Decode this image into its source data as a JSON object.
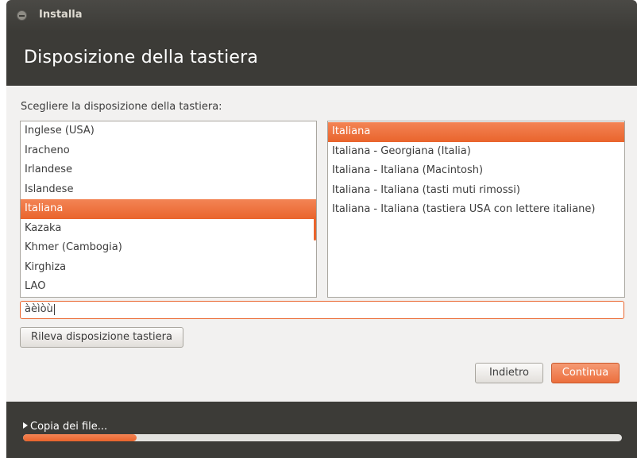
{
  "window": {
    "title": "Installa"
  },
  "header": {
    "title": "Disposizione della tastiera"
  },
  "main": {
    "prompt": "Scegliere la disposizione della tastiera:",
    "layouts": [
      {
        "label": "Inglese (USA)",
        "selected": false
      },
      {
        "label": "Iracheno",
        "selected": false
      },
      {
        "label": "Irlandese",
        "selected": false
      },
      {
        "label": "Islandese",
        "selected": false
      },
      {
        "label": "Italiana",
        "selected": true
      },
      {
        "label": "Kazaka",
        "selected": false
      },
      {
        "label": "Khmer (Cambogia)",
        "selected": false
      },
      {
        "label": "Kirghiza",
        "selected": false
      },
      {
        "label": "LAO",
        "selected": false
      }
    ],
    "variants": [
      {
        "label": "Italiana",
        "selected": true
      },
      {
        "label": "Italiana - Georgiana (Italia)",
        "selected": false
      },
      {
        "label": "Italiana - Italiana (Macintosh)",
        "selected": false
      },
      {
        "label": "Italiana - Italiana (tasti muti rimossi)",
        "selected": false
      },
      {
        "label": "Italiana - Italiana (tastiera USA con lettere italiane)",
        "selected": false
      }
    ],
    "test_input_value": "àèìòù",
    "detect_button": "Rileva disposizione tastiera"
  },
  "buttons": {
    "back": "Indietro",
    "continue": "Continua"
  },
  "footer": {
    "status": "Copia dei file...",
    "progress": 0.19
  },
  "colors": {
    "accent": "#e9642c",
    "header_bg": "#3c3b37",
    "content_bg": "#f2f1f0"
  }
}
